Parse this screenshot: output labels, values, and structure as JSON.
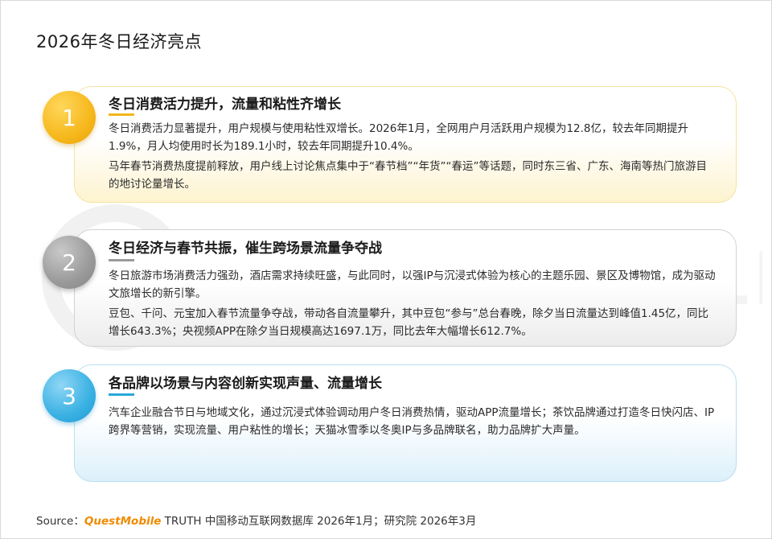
{
  "page": {
    "title": "2026年冬日经济亮点"
  },
  "watermark": {
    "text": "QUESTMOBILE"
  },
  "cards": [
    {
      "number": "1",
      "title": "冬日消费活力提升，流量和粘性齐增长",
      "paragraphs": [
        "冬日消费活力显著提升，用户规模与使用粘性双增长。2026年1月，全网用户月活跃用户规模为12.8亿，较去年同期提升1.9%，月人均使用时长为189.1小时，较去年同期提升10.4%。",
        "马年春节消费热度提前释放，用户线上讨论焦点集中于“春节档”“年货”“春运”等话题，同时东三省、广东、海南等热门旅游目的地讨论量增长。"
      ]
    },
    {
      "number": "2",
      "title": "冬日经济与春节共振，催生跨场景流量争夺战",
      "paragraphs": [
        "冬日旅游市场消费活力强劲，酒店需求持续旺盛，与此同时，以强IP与沉浸式体验为核心的主题乐园、景区及博物馆，成为驱动文旅增长的新引擎。",
        "豆包、千问、元宝加入春节流量争夺战，带动各自流量攀升，其中豆包“参与”总台春晚，除夕当日流量达到峰值1.45亿，同比增长643.3%；央视频APP在除夕当日规模高达1697.1万，同比去年大幅增长612.7%。"
      ]
    },
    {
      "number": "3",
      "title": "各品牌以场景与内容创新实现声量、流量增长",
      "paragraphs": [
        "汽车企业融合节日与地域文化，通过沉浸式体验调动用户冬日消费热情，驱动APP流量增长；茶饮品牌通过打造冬日快闪店、IP跨界等营销，实现流量、用户粘性的增长；天猫冰雪季以冬奥IP与多品牌联名，助力品牌扩大声量。"
      ]
    }
  ],
  "source": {
    "prefix": "Source：",
    "brand": "QuestMobile",
    "text": " TRUTH 中国移动互联网数据库 2026年1月；研究院 2026年3月"
  },
  "colors": {
    "accent1": "#f3b61a",
    "accent2": "#9a9a9a",
    "accent3": "#2aa7dc",
    "brand": "#f08a00"
  }
}
